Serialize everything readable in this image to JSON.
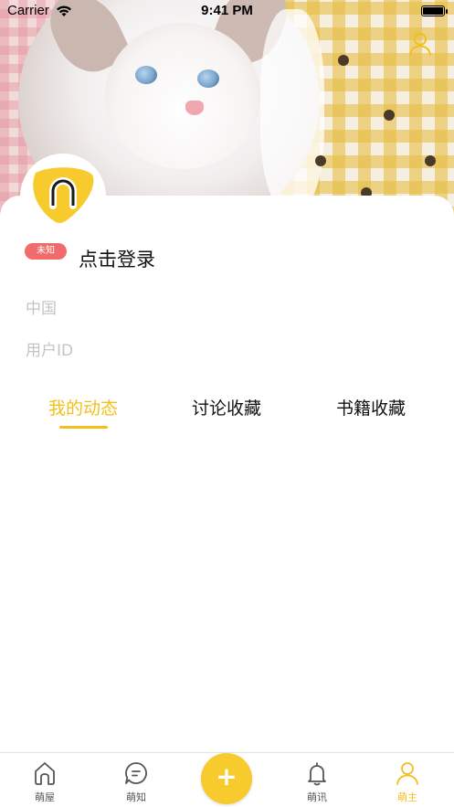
{
  "status_bar": {
    "carrier": "Carrier",
    "time": "9:41 PM"
  },
  "profile": {
    "badge": "未知",
    "login_text": "点击登录",
    "region": "中国",
    "user_id_label": "用户ID"
  },
  "tabs": [
    {
      "label": "我的动态",
      "active": true
    },
    {
      "label": "讨论收藏",
      "active": false
    },
    {
      "label": "书籍收藏",
      "active": false
    }
  ],
  "tab_bar": {
    "items": [
      {
        "label": "萌屋",
        "icon": "home-icon"
      },
      {
        "label": "萌知",
        "icon": "chat-icon"
      },
      {
        "label": "+",
        "icon": "plus-icon"
      },
      {
        "label": "萌讯",
        "icon": "bell-icon"
      },
      {
        "label": "萌主",
        "icon": "user-icon",
        "active": true
      }
    ]
  },
  "colors": {
    "accent": "#f2c01e",
    "badge": "#f26b6b",
    "muted_text": "#c4c4c4"
  }
}
